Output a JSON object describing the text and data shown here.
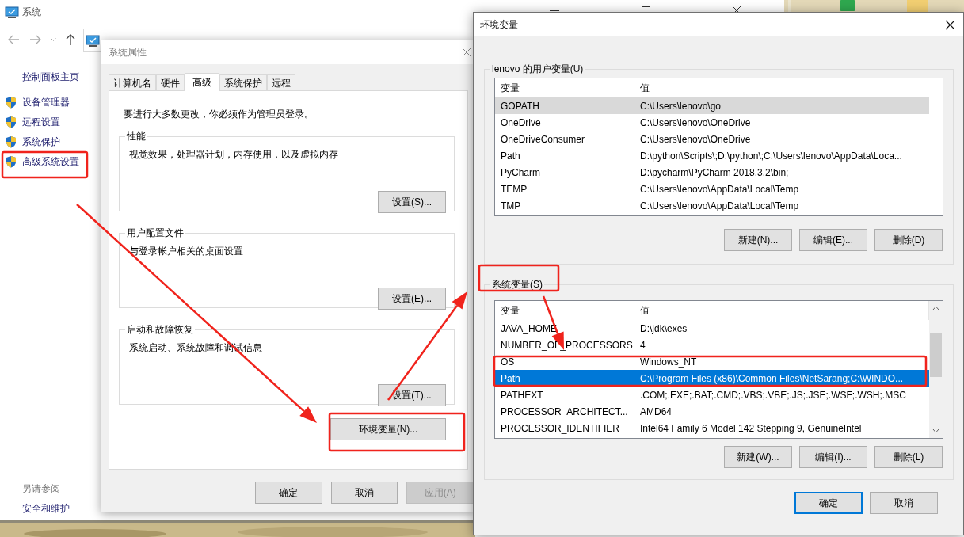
{
  "system_window": {
    "title": "系统",
    "sidebar_home": "控制面板主页",
    "sidebar_items": [
      {
        "label": "设备管理器"
      },
      {
        "label": "远程设置"
      },
      {
        "label": "系统保护"
      },
      {
        "label": "高级系统设置"
      }
    ],
    "see_also_title": "另请参阅",
    "see_also_items": [
      "安全和维护"
    ]
  },
  "properties_dialog": {
    "title": "系统属性",
    "tabs": [
      {
        "label": "计算机名",
        "selected": false
      },
      {
        "label": "硬件",
        "selected": false
      },
      {
        "label": "高级",
        "selected": true
      },
      {
        "label": "系统保护",
        "selected": false
      },
      {
        "label": "远程",
        "selected": false
      }
    ],
    "notice": "要进行大多数更改，你必须作为管理员登录。",
    "groups": [
      {
        "title": "性能",
        "description": "视觉效果，处理器计划，内存使用，以及虚拟内存",
        "button": "设置(S)..."
      },
      {
        "title": "用户配置文件",
        "description": "与登录帐户相关的桌面设置",
        "button": "设置(E)..."
      },
      {
        "title": "启动和故障恢复",
        "description": "系统启动、系统故障和调试信息",
        "button": "设置(T)..."
      }
    ],
    "env_button": "环境变量(N)...",
    "buttons": [
      {
        "label": "确定",
        "disabled": false
      },
      {
        "label": "取消",
        "disabled": false
      },
      {
        "label": "应用(A)",
        "disabled": true
      }
    ]
  },
  "env_dialog": {
    "title": "环境变量",
    "user_group": {
      "title": "lenovo 的用户变量(U)",
      "focused": false,
      "columns": [
        "变量",
        "值"
      ],
      "rows": [
        {
          "name": "GOPATH",
          "value": "C:\\Users\\lenovo\\go",
          "selected": true
        },
        {
          "name": "OneDrive",
          "value": "C:\\Users\\lenovo\\OneDrive",
          "selected": false
        },
        {
          "name": "OneDriveConsumer",
          "value": "C:\\Users\\lenovo\\OneDrive",
          "selected": false
        },
        {
          "name": "Path",
          "value": "D:\\python\\Scripts\\;D:\\python\\;C:\\Users\\lenovo\\AppData\\Loca...",
          "selected": false
        },
        {
          "name": "PyCharm",
          "value": "D:\\pycharm\\PyCharm 2018.3.2\\bin;",
          "selected": false
        },
        {
          "name": "TEMP",
          "value": "C:\\Users\\lenovo\\AppData\\Local\\Temp",
          "selected": false
        },
        {
          "name": "TMP",
          "value": "C:\\Users\\lenovo\\AppData\\Local\\Temp",
          "selected": false
        }
      ],
      "buttons": [
        "新建(N)...",
        "编辑(E)...",
        "删除(D)"
      ]
    },
    "system_group": {
      "title": "系统变量(S)",
      "focused": true,
      "columns": [
        "变量",
        "值"
      ],
      "rows": [
        {
          "name": "JAVA_HOME",
          "value": "D:\\jdk\\exes",
          "selected": false
        },
        {
          "name": "NUMBER_OF_PROCESSORS",
          "value": "4",
          "selected": false
        },
        {
          "name": "OS",
          "value": "Windows_NT",
          "selected": false
        },
        {
          "name": "Path",
          "value": "C:\\Program Files (x86)\\Common Files\\NetSarang;C:\\WINDO...",
          "selected": true
        },
        {
          "name": "PATHEXT",
          "value": ".COM;.EXE;.BAT;.CMD;.VBS;.VBE;.JS;.JSE;.WSF;.WSH;.MSC",
          "selected": false
        },
        {
          "name": "PROCESSOR_ARCHITECT...",
          "value": "AMD64",
          "selected": false
        },
        {
          "name": "PROCESSOR_IDENTIFIER",
          "value": "Intel64 Family 6 Model 142 Stepping 9, GenuineIntel",
          "selected": false
        }
      ],
      "buttons": [
        "新建(W)...",
        "编辑(I)...",
        "删除(L)"
      ]
    },
    "buttons": [
      {
        "label": "确定",
        "default": true
      },
      {
        "label": "取消",
        "default": false
      }
    ]
  }
}
